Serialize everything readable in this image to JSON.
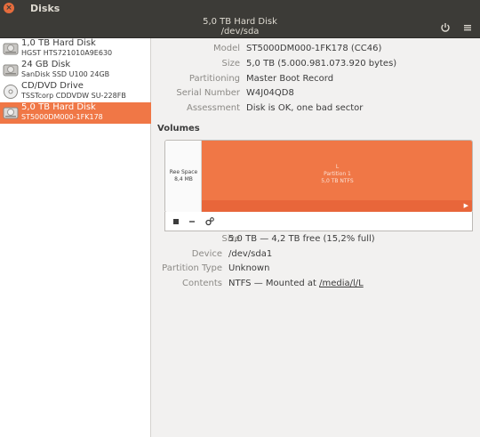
{
  "window": {
    "app_title": "Disks"
  },
  "header": {
    "title": "5,0 TB Hard Disk",
    "subtitle": "/dev/sda"
  },
  "drives": [
    {
      "name": "1,0 TB Hard Disk",
      "sub": "HGST HTS721010A9E630",
      "icon": "hard-disk-icon"
    },
    {
      "name": "24 GB Disk",
      "sub": "SanDisk SSD U100 24GB",
      "icon": "hard-disk-icon"
    },
    {
      "name": "CD/DVD Drive",
      "sub": "TSSTcorp CDDVDW SU-228FB",
      "icon": "optical-disc-icon"
    },
    {
      "name": "5,0 TB Hard Disk",
      "sub": "ST5000DM000-1FK178",
      "icon": "hard-disk-icon",
      "selected": true
    }
  ],
  "disk_props": {
    "model_label": "Model",
    "model": "ST5000DM000-1FK178 (CC46)",
    "size_label": "Size",
    "size": "5,0 TB (5.000.981.073.920 bytes)",
    "partitioning_label": "Partitioning",
    "partitioning": "Master Boot Record",
    "serial_label": "Serial Number",
    "serial": "W4J04QD8",
    "assessment_label": "Assessment",
    "assessment": "Disk is OK, one bad sector"
  },
  "volumes": {
    "title": "Volumes",
    "free_space_label": "Ree Space",
    "free_space_size": "8,4 MB",
    "partition_line0": "L",
    "partition_line1": "Partition 1",
    "partition_line2": "5,0 TB NTFS"
  },
  "partition_props": {
    "size_label": "Size",
    "size": "5,0 TB — 4,2 TB free (15,2% full)",
    "device_label": "Device",
    "device": "/dev/sda1",
    "type_label": "Partition Type",
    "type": "Unknown",
    "contents_label": "Contents",
    "contents_prefix": "NTFS — Mounted at ",
    "contents_link": "/media/l/L"
  },
  "colors": {
    "accent": "#f07746",
    "titlebar": "#3c3b37"
  }
}
